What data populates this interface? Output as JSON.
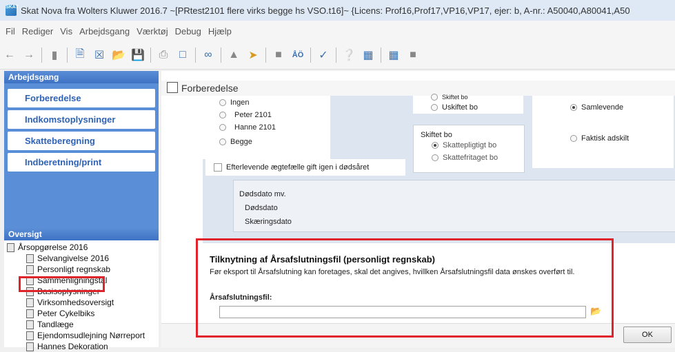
{
  "window": {
    "title": "Skat Nova fra Wolters Kluwer 2016.7   ~[PRtest2101 flere virks begge hs VSO.t16]~    {Licens: Prof16,Prof17,VP16,VP17, ejer: b, A-nr.: A50040,A80041,A50",
    "icon_text": "SKAT"
  },
  "menu": [
    "Fil",
    "Rediger",
    "Vis",
    "Arbejdsgang",
    "Værktøj",
    "Debug",
    "Hjælp"
  ],
  "toolbar": {
    "icons": [
      "back-arrow-icon",
      "forward-arrow-icon",
      "book-icon",
      "page-icon",
      "page-x-icon",
      "folder-open-icon",
      "save-icon",
      "print-icon",
      "preview-icon",
      "link-icon",
      "person-icon",
      "transfer-icon",
      "book-dark-icon",
      "text-ao-icon",
      "check-icon",
      "help-icon",
      "grid-icon",
      "calculator-icon",
      "panel-icon"
    ]
  },
  "left": {
    "arbejdsgang_header": "Arbejdsgang",
    "nav": [
      "Forberedelse",
      "Indkomstoplysninger",
      "Skatteberegning",
      "Indberetning/print"
    ],
    "oversigt_header": "Oversigt",
    "tree_root": "Årsopgørelse 2016",
    "tree_children": [
      "Selvangivelse 2016",
      "Personligt regnskab",
      "Sammenligningstal",
      "Basisoplysninger",
      "Virksomhedsoversigt",
      "Peter Cykelbiks",
      "Tandlæge",
      "Ejendomsudlejning Nørreport",
      "Hannes Dekoration"
    ]
  },
  "form": {
    "window_title": "Forberedelse",
    "radios_left": [
      "Ingen",
      "Peter 2101",
      "Hanne 2101",
      "Begge"
    ],
    "radios_top_mid": [
      "Skiftet bo",
      "Uskiftet bo"
    ],
    "skiftet_bo_label": "Skiftet bo",
    "radios_skiftet": [
      "Skattepligtigt bo",
      "Skattefritaget bo"
    ],
    "radios_right": [
      "Samlevende",
      "Faktisk adskilt"
    ],
    "checkbox_label": "Efterlevende ægtefælle gift igen i dødsåret",
    "dodsdato_group": "Dødsdato mv.",
    "dodsdato": "Dødsdato",
    "skaeringsdato": "Skæringsdato"
  },
  "link": {
    "title": "Tilknytning af Årsafslutningsfil (personligt regnskab)",
    "description": "Før eksport til Årsafslutning kan foretages, skal det angives, hvillken Årsafslutningsfil data ønskes overført til.",
    "field_label": "Årsafslutningsfil:",
    "field_value": ""
  },
  "buttons": {
    "ok": "OK"
  }
}
